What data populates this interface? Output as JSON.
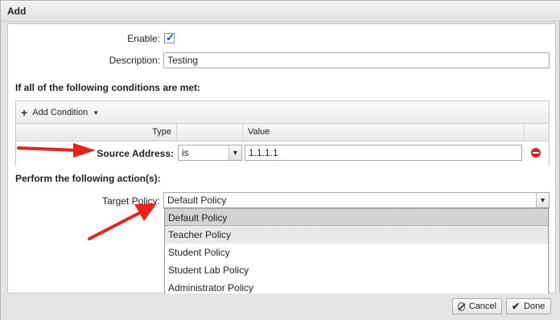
{
  "dialog": {
    "title": "Add"
  },
  "form": {
    "enable_label": "Enable:",
    "enable_checked": true,
    "description_label": "Description:",
    "description_value": "Testing"
  },
  "conditions": {
    "heading": "If all of the following conditions are met:",
    "add_condition_label": "Add Condition",
    "columns": {
      "type": "Type",
      "operator": "",
      "value": "Value"
    },
    "row": {
      "type": "Source Address:",
      "operator": "is",
      "value": "1.1.1.1"
    }
  },
  "actions": {
    "heading": "Perform the following action(s):",
    "target_policy_label": "Target Policy:",
    "target_policy_value": "Default Policy",
    "options": [
      "Default Policy",
      "Teacher Policy",
      "Student Policy",
      "Student Lab Policy",
      "Administrator Policy"
    ]
  },
  "footer": {
    "cancel_label": "Cancel",
    "done_label": "Done"
  },
  "colors": {
    "annotation_arrow": "#e8231c",
    "remove_icon": "#d9221c",
    "checkbox_tick": "#1b4f9c"
  }
}
